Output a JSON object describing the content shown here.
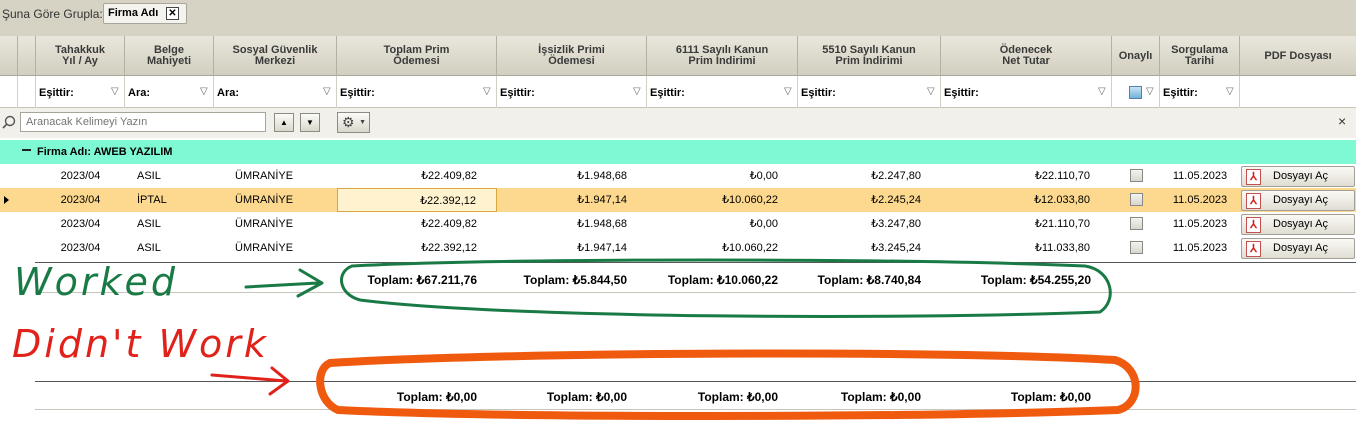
{
  "group_bar": {
    "label": "Şuna Göre Grupla:",
    "chip": "Firma Adı",
    "chip_close": "✕"
  },
  "columns": [
    "Tahakkuk\nYıl / Ay",
    "Belge\nMahiyeti",
    "Sosyal Güvenlik\nMerkezi",
    "Toplam Prim\nÖdemesi",
    "İşsizlik Primi\nÖdemesi",
    "6111 Sayılı Kanun\nPrim İndirimi",
    "5510 Sayılı Kanun\nPrim İndirimi",
    "Ödenecek\nNet Tutar",
    "Onaylı",
    "Sorgulama\nTarihi",
    "PDF Dosyası"
  ],
  "filters": [
    "Eşittir:",
    "Ara:",
    "Ara:",
    "Eşittir:",
    "Eşittir:",
    "Eşittir:",
    "Eşittir:",
    "Eşittir:",
    "",
    "Eşittir:"
  ],
  "search": {
    "placeholder": "Aranacak Kelimeyi Yazın",
    "up": "▲",
    "down": "▼",
    "gear": "⚙",
    "close": "×"
  },
  "group_row": {
    "text": "Firma Adı: AWEB YAZILIM"
  },
  "rows": [
    {
      "period": "2023/04",
      "type": "ASIL",
      "center": "ÜMRANİYE",
      "total": "₺22.409,82",
      "unemp": "₺1.948,68",
      "k6111": "₺0,00",
      "k5510": "₺2.247,80",
      "net": "₺22.110,70",
      "date": "11.05.2023",
      "pdf": "Dosyayı Aç"
    },
    {
      "period": "2023/04",
      "type": "İPTAL",
      "center": "ÜMRANİYE",
      "total": "₺22.392,12",
      "unemp": "₺1.947,14",
      "k6111": "₺10.060,22",
      "k5510": "₺2.245,24",
      "net": "₺12.033,80",
      "date": "11.05.2023",
      "pdf": "Dosyayı Aç"
    },
    {
      "period": "2023/04",
      "type": "ASIL",
      "center": "ÜMRANİYE",
      "total": "₺22.409,82",
      "unemp": "₺1.948,68",
      "k6111": "₺0,00",
      "k5510": "₺3.247,80",
      "net": "₺21.110,70",
      "date": "11.05.2023",
      "pdf": "Dosyayı Aç"
    },
    {
      "period": "2023/04",
      "type": "ASIL",
      "center": "ÜMRANİYE",
      "total": "₺22.392,12",
      "unemp": "₺1.947,14",
      "k6111": "₺10.060,22",
      "k5510": "₺3.245,24",
      "net": "₺11.033,80",
      "date": "11.05.2023",
      "pdf": "Dosyayı Aç"
    }
  ],
  "summary_worked": [
    "Toplam: ₺67.211,76",
    "Toplam: ₺5.844,50",
    "Toplam: ₺10.060,22",
    "Toplam: ₺8.740,84",
    "Toplam: ₺54.255,20"
  ],
  "summary_failed": [
    "Toplam: ₺0,00",
    "Toplam: ₺0,00",
    "Toplam: ₺0,00",
    "Toplam: ₺0,00",
    "Toplam: ₺0,00"
  ],
  "annotations": {
    "worked": "Worked",
    "didnt_work": "Didn't Work",
    "green": "#1a7a45",
    "red": "#e0221b",
    "orange": "#ef5a0f"
  },
  "colors": {
    "group_row": "#7ff8d4",
    "selected_row": "#fcd98f",
    "header": "#d6d3c4"
  }
}
